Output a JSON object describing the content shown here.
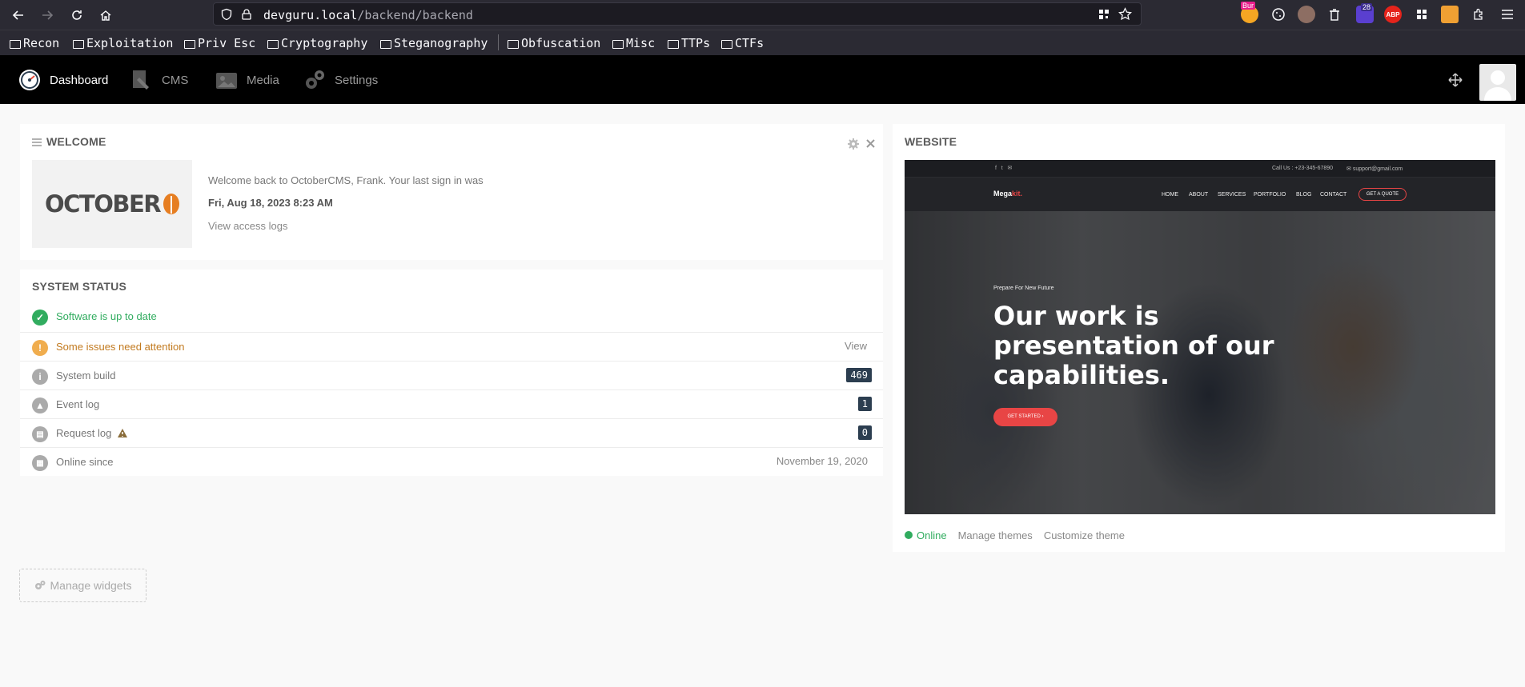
{
  "browser": {
    "url_host": "devguru.local",
    "url_path": "/backend/backend",
    "extension_badges": {
      "bur": "Bur",
      "count": "28",
      "abp": "ABP"
    },
    "bookmarks": [
      "Recon",
      "Exploitation",
      "Priv Esc",
      "Cryptography",
      "Steganography",
      "Obfuscation",
      "Misc",
      "TTPs",
      "CTFs"
    ]
  },
  "topnav": {
    "items": [
      {
        "label": "Dashboard",
        "icon": "dashboard-icon",
        "active": true
      },
      {
        "label": "CMS",
        "icon": "cms-icon",
        "active": false
      },
      {
        "label": "Media",
        "icon": "media-icon",
        "active": false
      },
      {
        "label": "Settings",
        "icon": "settings-icon",
        "active": false
      }
    ]
  },
  "welcome": {
    "title": "WELCOME",
    "logo_text": "OCTOBER",
    "message": "Welcome back to OctoberCMS, Frank. Your last sign in was",
    "last_signin": "Fri, Aug 18, 2023 8:23 AM",
    "access_logs_link": "View access logs"
  },
  "system_status": {
    "title": "SYSTEM STATUS",
    "rows": [
      {
        "label": "Software is up to date",
        "value": "",
        "icon": "check-icon",
        "color": "#31ac5f"
      },
      {
        "label": "Some issues need attention",
        "value": "View",
        "icon": "exclamation-icon",
        "color": "#f0ad4e"
      },
      {
        "label": "System build",
        "value": "469",
        "icon": "info-icon",
        "color": "#aaaaaa"
      },
      {
        "label": "Event log",
        "value": "1",
        "icon": "warning-triangle-icon",
        "color": "#aaaaaa"
      },
      {
        "label": "Request log",
        "value": "0",
        "icon": "document-icon",
        "color": "#aaaaaa"
      },
      {
        "label": "Online since",
        "value": "November 19, 2020",
        "icon": "calendar-icon",
        "color": "#aaaaaa"
      }
    ]
  },
  "website": {
    "title": "WEBSITE",
    "preview": {
      "call_us": "Call Us : +23-345-67890",
      "email": "support@gmail.com",
      "brand": "Mega",
      "brand_accent": "kit.",
      "nav_links": [
        "HOME",
        "ABOUT",
        "SERVICES",
        "PORTFOLIO",
        "BLOG",
        "CONTACT"
      ],
      "quote_button": "GET A QUOTE",
      "tagline": "Prepare For New Future",
      "headline": "Our work is presentation of our capabilities.",
      "cta": "GET STARTED"
    },
    "status": "Online",
    "manage_themes": "Manage themes",
    "customize_theme": "Customize theme"
  },
  "manage_widgets": "Manage widgets",
  "colors": {
    "accent_green": "#31ac5f",
    "warning_orange": "#f0ad4e",
    "badge_dark": "#2c3e50",
    "nav_bg": "#000000",
    "preview_red": "#e84545"
  }
}
